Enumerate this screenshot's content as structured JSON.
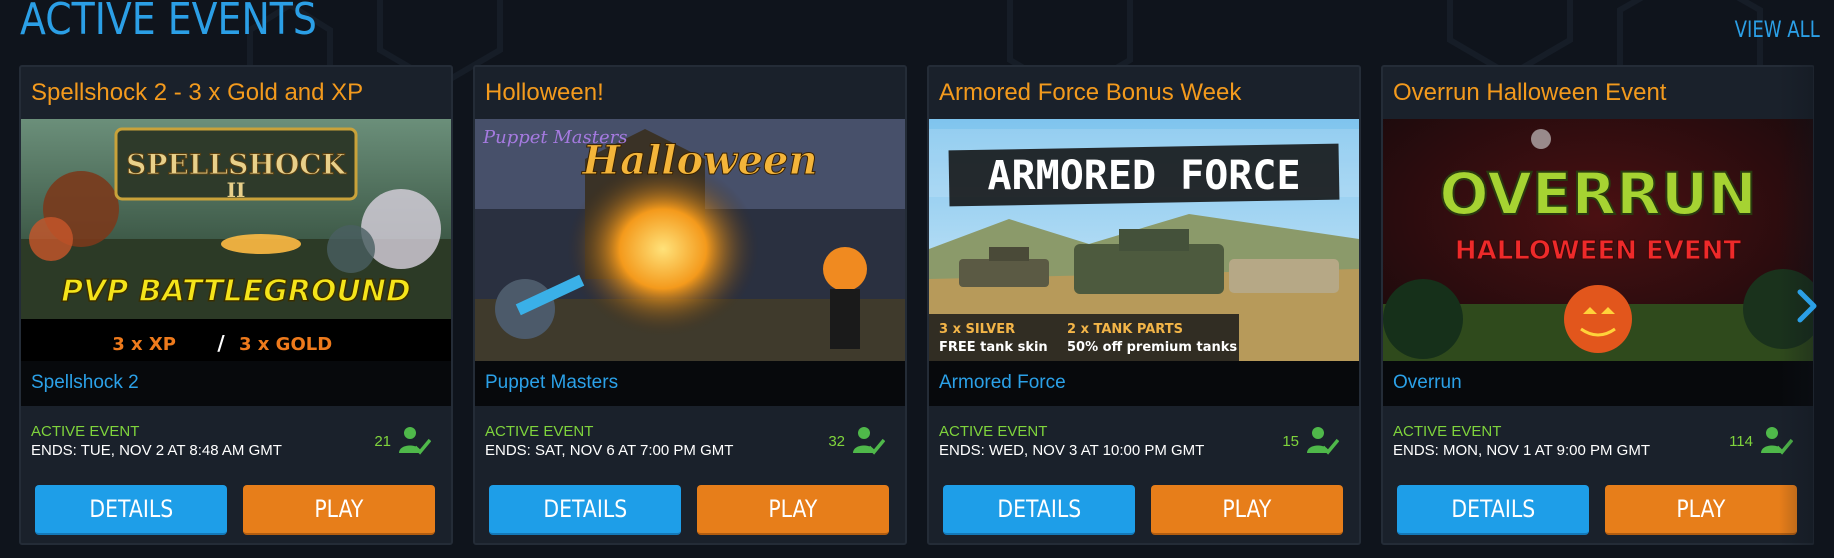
{
  "header": {
    "title": "ACTIVE EVENTS",
    "view_all_label": "VIEW ALL"
  },
  "cards": [
    {
      "title": "Spellshock 2 - 3 x Gold and XP",
      "image": {
        "logo": "SPELLSHOCK",
        "logo_sub": "II",
        "banner": "PVP BATTLEGROUND",
        "bonus_a": "3 x XP",
        "sep": "/",
        "bonus_b": "3 x GOLD"
      },
      "game": "Spellshock 2",
      "status": "ACTIVE EVENT",
      "ends": "ENDS: TUE, NOV 2 AT 8:48 AM GMT",
      "players": "21",
      "details_label": "DETAILS",
      "play_label": "PLAY"
    },
    {
      "title": "Holloween!",
      "image": {
        "brand": "Puppet Masters",
        "headline": "Halloween"
      },
      "game": "Puppet Masters",
      "status": "ACTIVE EVENT",
      "ends": "ENDS: SAT, NOV 6 AT 7:00 PM GMT",
      "players": "32",
      "details_label": "DETAILS",
      "play_label": "PLAY"
    },
    {
      "title": "Armored Force Bonus Week",
      "image": {
        "headline": "ARMORED FORCE",
        "line1a": "3 x SILVER",
        "line1b": "2 x TANK PARTS",
        "line2a": "FREE tank skin",
        "line2b": "50% off premium tanks"
      },
      "game": "Armored Force",
      "status": "ACTIVE EVENT",
      "ends": "ENDS: WED, NOV 3 AT 10:00 PM GMT",
      "players": "15",
      "details_label": "DETAILS",
      "play_label": "PLAY"
    },
    {
      "title": "Overrun Halloween Event",
      "image": {
        "headline": "OVERRUN",
        "sub": "HALLOWEEN EVENT"
      },
      "game": "Overrun",
      "status": "ACTIVE EVENT",
      "ends": "ENDS: MON, NOV 1 AT 9:00 PM GMT",
      "players": "114",
      "details_label": "DETAILS",
      "play_label": "PLAY"
    }
  ],
  "colors": {
    "accent_blue": "#2b9fe6",
    "accent_orange": "#f39a1d",
    "active_green": "#7fd43c",
    "details_button": "#1e9ee8",
    "play_button": "#e77e1a"
  },
  "icons": {
    "players": "user-check-icon",
    "next": "chevron-right-icon"
  }
}
